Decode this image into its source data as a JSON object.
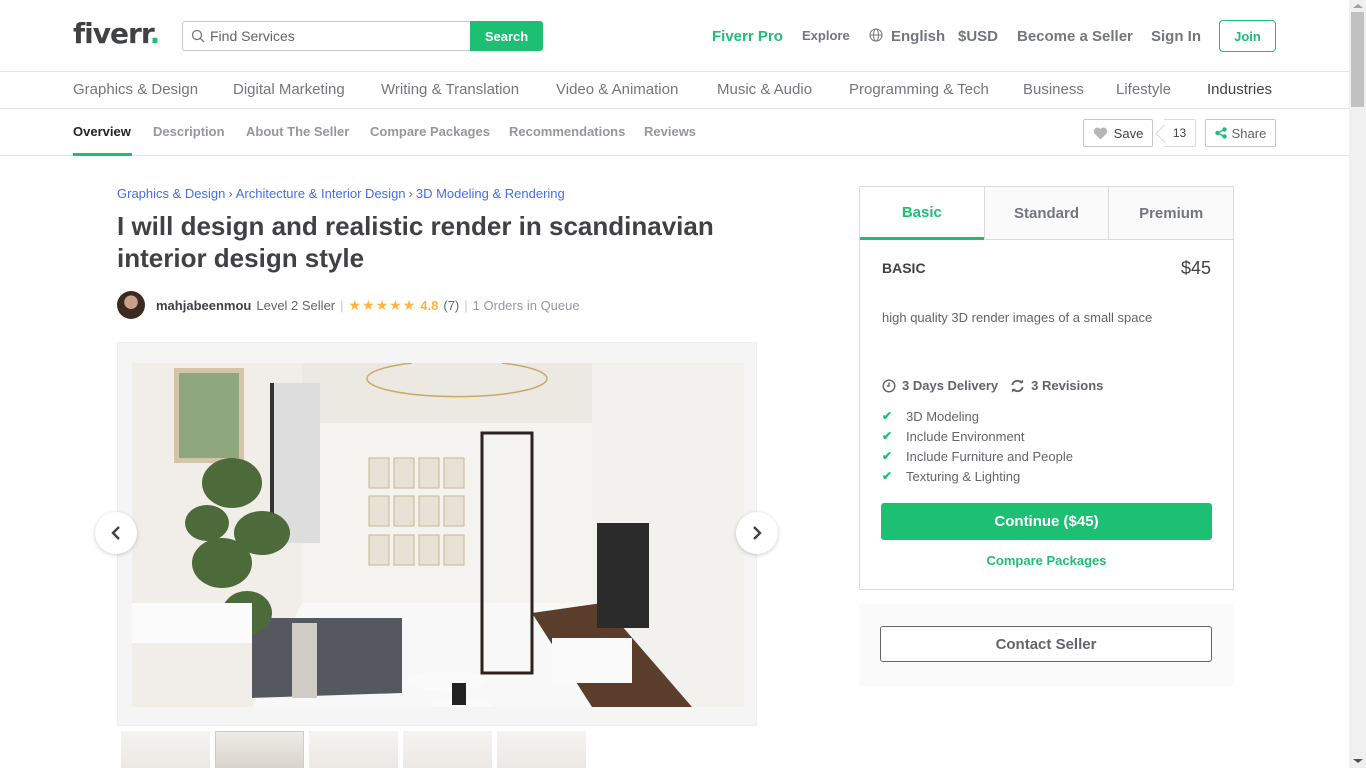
{
  "header": {
    "logo": "fiverr",
    "logo_dot": ".",
    "search_placeholder": "Find Services",
    "search_button": "Search",
    "nav": {
      "fiverr_pro": "Fiverr Pro",
      "explore": "Explore",
      "language": "English",
      "currency": "$USD",
      "become_seller": "Become a Seller",
      "sign_in": "Sign In",
      "join": "Join"
    }
  },
  "categories": [
    "Graphics & Design",
    "Digital Marketing",
    "Writing & Translation",
    "Video & Animation",
    "Music & Audio",
    "Programming & Tech",
    "Business",
    "Lifestyle",
    "Industries"
  ],
  "subnav": {
    "tabs": [
      "Overview",
      "Description",
      "About The Seller",
      "Compare Packages",
      "Recommendations",
      "Reviews"
    ],
    "active": "Overview",
    "save_label": "Save",
    "save_count": "13",
    "share_label": "Share"
  },
  "gig": {
    "breadcrumb": [
      "Graphics & Design",
      "Architecture & Interior Design",
      "3D Modeling & Rendering"
    ],
    "title": "I will design and realistic render in scandinavian interior design style",
    "seller": {
      "name": "mahjabeenmou",
      "level": "Level 2 Seller",
      "stars": "★★★★★",
      "rating": "4.8",
      "reviews": "(7)",
      "queue": "1 Orders in Queue"
    },
    "thumbnail_count": 5,
    "selected_thumbnail": 2
  },
  "package": {
    "tabs": [
      "Basic",
      "Standard",
      "Premium"
    ],
    "active_tab": "Basic",
    "name": "BASIC",
    "price": "$45",
    "description": "high quality 3D render images of a small space",
    "delivery": "3 Days Delivery",
    "revisions": "3 Revisions",
    "features": [
      "3D Modeling",
      "Include Environment",
      "Include Furniture and People",
      "Texturing & Lighting"
    ],
    "continue_label": "Continue ($45)",
    "compare_label": "Compare Packages",
    "contact_label": "Contact Seller"
  },
  "colors": {
    "brand": "#1dbf73",
    "link": "#446ee7",
    "star": "#ffb33e"
  }
}
